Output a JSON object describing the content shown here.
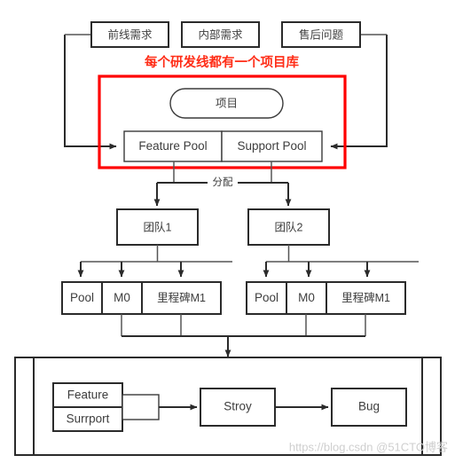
{
  "diagram": {
    "title_note": "每个研发线都有一个项目库",
    "accent_color": "#ff0000",
    "line_color": "#2b2b2b",
    "watermark": "https://blog.csdn @51CTO博客",
    "sources": [
      {
        "id": "front-line-demand",
        "label": "前线需求"
      },
      {
        "id": "internal-demand",
        "label": "内部需求"
      },
      {
        "id": "after-sales-issue",
        "label": "售后问题"
      }
    ],
    "project_node": {
      "id": "project",
      "label": "项目"
    },
    "pools": [
      {
        "id": "feature-pool",
        "label": "Feature Pool"
      },
      {
        "id": "support-pool",
        "label": "Support Pool"
      }
    ],
    "allocation_label": "分配",
    "teams": [
      {
        "id": "team-1",
        "label": "团队1"
      },
      {
        "id": "team-2",
        "label": "团队2"
      }
    ],
    "team_items_left": [
      {
        "id": "team1-pool",
        "label": "Pool"
      },
      {
        "id": "team1-m0",
        "label": "M0"
      },
      {
        "id": "team1-m1",
        "label": "里程碑M1"
      }
    ],
    "team_items_right": [
      {
        "id": "team2-pool",
        "label": "Pool"
      },
      {
        "id": "team2-m0",
        "label": "M0"
      },
      {
        "id": "team2-m1",
        "label": "里程碑M1"
      }
    ],
    "backlog": [
      {
        "id": "feature-item",
        "label": "Feature"
      },
      {
        "id": "surrport-item",
        "label": "Surrport"
      }
    ],
    "workflow": [
      {
        "id": "stroy",
        "label": "Stroy"
      },
      {
        "id": "bug",
        "label": "Bug"
      }
    ]
  }
}
